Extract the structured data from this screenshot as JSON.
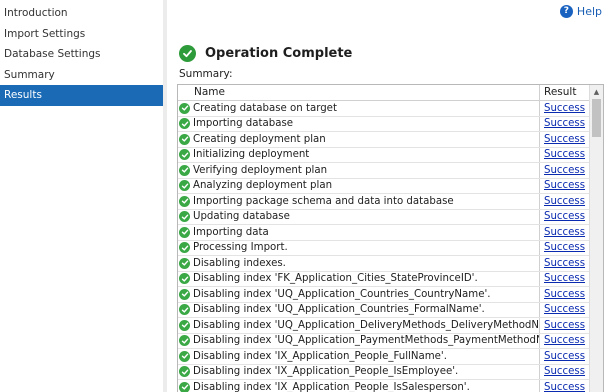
{
  "sidebar": {
    "items": [
      {
        "label": "Introduction",
        "active": false
      },
      {
        "label": "Import Settings",
        "active": false
      },
      {
        "label": "Database Settings",
        "active": false
      },
      {
        "label": "Summary",
        "active": false
      },
      {
        "label": "Results",
        "active": true
      }
    ]
  },
  "help": {
    "label": "Help",
    "icon": "help-icon"
  },
  "operation": {
    "title": "Operation Complete",
    "status_icon": "success-check-icon",
    "summary_label": "Summary:"
  },
  "table": {
    "columns": [
      "Name",
      "Result"
    ],
    "rows": [
      {
        "name": "Creating database on target",
        "result": "Success"
      },
      {
        "name": "Importing database",
        "result": "Success"
      },
      {
        "name": "Creating deployment plan",
        "result": "Success"
      },
      {
        "name": "Initializing deployment",
        "result": "Success"
      },
      {
        "name": "Verifying deployment plan",
        "result": "Success"
      },
      {
        "name": "Analyzing deployment plan",
        "result": "Success"
      },
      {
        "name": "Importing package schema and data into database",
        "result": "Success"
      },
      {
        "name": "Updating database",
        "result": "Success"
      },
      {
        "name": "Importing data",
        "result": "Success"
      },
      {
        "name": "Processing Import.",
        "result": "Success"
      },
      {
        "name": "Disabling indexes.",
        "result": "Success"
      },
      {
        "name": "Disabling index 'FK_Application_Cities_StateProvinceID'.",
        "result": "Success"
      },
      {
        "name": "Disabling index 'UQ_Application_Countries_CountryName'.",
        "result": "Success"
      },
      {
        "name": "Disabling index 'UQ_Application_Countries_FormalName'.",
        "result": "Success"
      },
      {
        "name": "Disabling index 'UQ_Application_DeliveryMethods_DeliveryMethodName'.",
        "result": "Success"
      },
      {
        "name": "Disabling index 'UQ_Application_PaymentMethods_PaymentMethodName'.",
        "result": "Success"
      },
      {
        "name": "Disabling index 'IX_Application_People_FullName'.",
        "result": "Success"
      },
      {
        "name": "Disabling index 'IX_Application_People_IsEmployee'.",
        "result": "Success"
      },
      {
        "name": "Disabling index 'IX_Application_People_IsSalesperson'.",
        "result": "Success"
      }
    ]
  },
  "colors": {
    "accent": "#1a6ab5",
    "success": "#3aa845",
    "link": "#0a2ab0"
  }
}
